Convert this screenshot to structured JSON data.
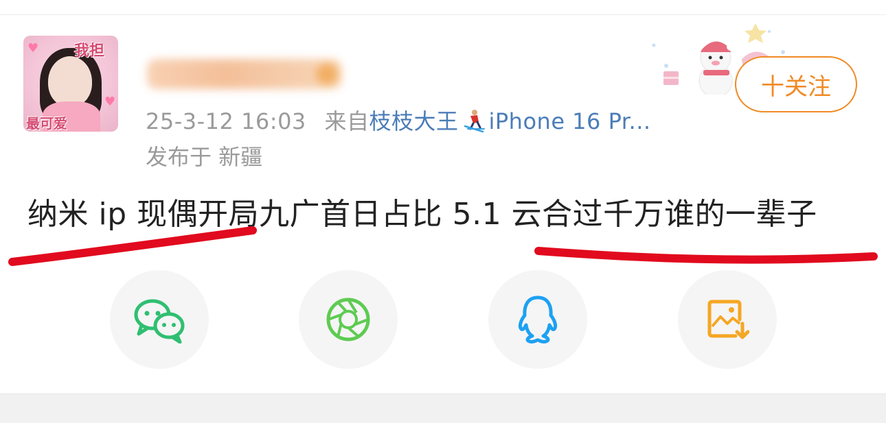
{
  "avatar": {
    "text_top": "我担",
    "text_bottom": "最可爱"
  },
  "post": {
    "username": "",
    "timestamp": "25-3-12 16:03",
    "source_prefix": "来自",
    "source_name": "枝枝大王",
    "device": "iPhone 16 Pr...",
    "location": "发布于 新疆",
    "content": "纳米 ip 现偶开局九广首日占比 5.1 云合过千万谁的一辈子"
  },
  "follow_button": {
    "label": "十关注"
  },
  "share": {
    "items": [
      {
        "name": "wechat-icon",
        "color": "#2fbf71"
      },
      {
        "name": "moments-icon",
        "color": "#5ecb52"
      },
      {
        "name": "qq-icon",
        "color": "#1da1f2"
      },
      {
        "name": "save-image-icon",
        "color": "#f5a623"
      }
    ]
  },
  "colors": {
    "accent": "#f08a24",
    "link": "#4b7db8",
    "meta": "#9a9a9a",
    "annotation": "#e10a1e"
  }
}
